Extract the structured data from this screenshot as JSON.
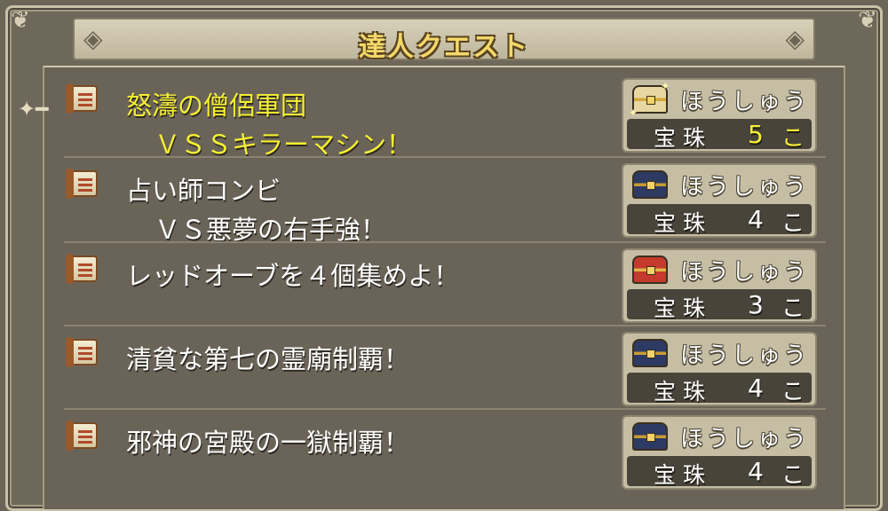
{
  "title": "達人クエスト",
  "quests": [
    {
      "title": "怒濤の僧侶軍団",
      "subtitle": "ＶＳＳキラーマシン！",
      "reward_label": "ほうしゅう",
      "reward_item": "宝珠",
      "reward_count": "5",
      "reward_unit": "こ",
      "chest": "gold-chest-icon",
      "selected": true
    },
    {
      "title": "占い師コンビ",
      "subtitle": "ＶＳ悪夢の右手強！",
      "reward_label": "ほうしゅう",
      "reward_item": "宝珠",
      "reward_count": "4",
      "reward_unit": "こ",
      "chest": "blue-chest-icon",
      "selected": false
    },
    {
      "title": "レッドオーブを４個集めよ！",
      "subtitle": "",
      "reward_label": "ほうしゅう",
      "reward_item": "宝珠",
      "reward_count": "3",
      "reward_unit": "こ",
      "chest": "red-chest-icon",
      "selected": false
    },
    {
      "title": "清貧な第七の霊廟制覇！",
      "subtitle": "",
      "reward_label": "ほうしゅう",
      "reward_item": "宝珠",
      "reward_count": "4",
      "reward_unit": "こ",
      "chest": "blue-chest-icon",
      "selected": false
    },
    {
      "title": "邪神の宮殿の一獄制覇！",
      "subtitle": "",
      "reward_label": "ほうしゅう",
      "reward_item": "宝珠",
      "reward_count": "4",
      "reward_unit": "こ",
      "chest": "blue-chest-icon",
      "selected": false
    }
  ],
  "colors": {
    "selected_text": "#f5ef32",
    "title_gold": "#f3d86a",
    "background": "#6b6558"
  }
}
